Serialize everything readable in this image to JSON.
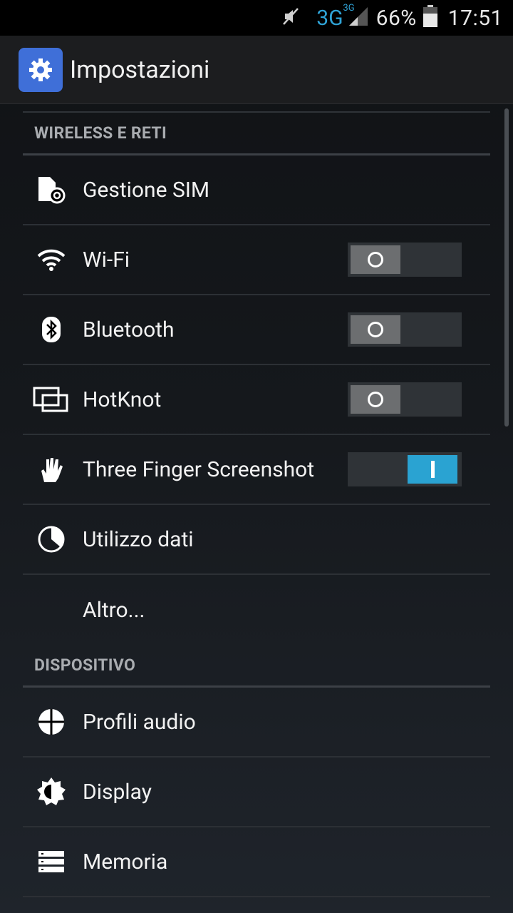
{
  "status_bar": {
    "network": "3G",
    "network_sup": "3G",
    "battery": "66%",
    "time": "17:51"
  },
  "action_bar": {
    "title": "Impostazioni",
    "icon": "gear-icon"
  },
  "sections": [
    {
      "header": "WIRELESS E RETI",
      "items": [
        {
          "label": "Gestione SIM",
          "icon": "sim-card-icon"
        },
        {
          "label": "Wi-Fi",
          "icon": "wifi-icon",
          "toggle": "off"
        },
        {
          "label": "Bluetooth",
          "icon": "bluetooth-icon",
          "toggle": "off"
        },
        {
          "label": "HotKnot",
          "icon": "hotknot-icon",
          "toggle": "off"
        },
        {
          "label": "Three Finger Screenshot",
          "icon": "hand-icon",
          "toggle": "on"
        },
        {
          "label": "Utilizzo dati",
          "icon": "data-usage-icon"
        },
        {
          "label": "Altro...",
          "icon": ""
        }
      ]
    },
    {
      "header": "DISPOSITIVO",
      "items": [
        {
          "label": "Profili audio",
          "icon": "audio-profiles-icon"
        },
        {
          "label": "Display",
          "icon": "brightness-icon"
        },
        {
          "label": "Memoria",
          "icon": "storage-icon"
        }
      ]
    }
  ],
  "colors": {
    "accent": "#2aa3d2",
    "toggle_off_knob": "#6c6e70",
    "app_icon_bg": "#3f6fd8"
  }
}
